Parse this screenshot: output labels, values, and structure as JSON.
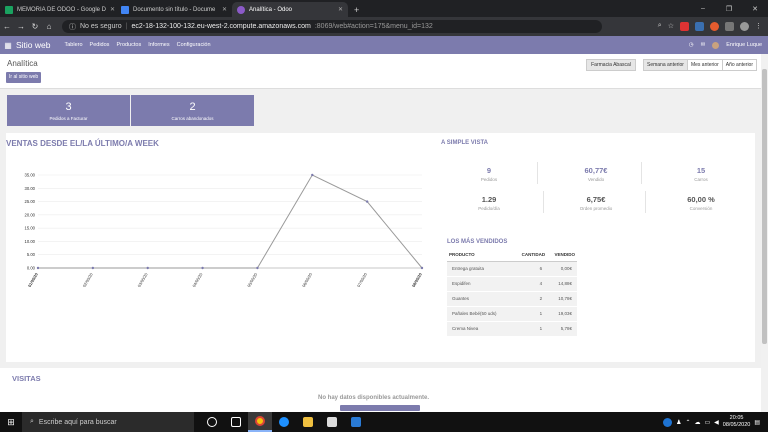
{
  "browser": {
    "tabs": [
      {
        "label": "MEMORIA DE ODOO - Google D",
        "color": "#1aa260"
      },
      {
        "label": "Documento sin título - Docume",
        "color": "#4285f4"
      },
      {
        "label": "Analítica - Odoo",
        "color": "#8b5ac8"
      }
    ],
    "new_tab": "+",
    "security": "No es seguro",
    "url_host": "ec2-18-132-100-132.eu-west-2.compute.amazonaws.com",
    "url_path": ":8069/web#action=175&menu_id=132"
  },
  "odoo_nav": {
    "brand": "Sitio web",
    "menus": [
      "Tablero",
      "Pedidos",
      "Productos",
      "Informes",
      "Configuración"
    ],
    "user": "Enrique Luque"
  },
  "control": {
    "breadcrumb": "Analítica",
    "go_site": "Ir al sitio web",
    "shop": "Farmacia Abascal",
    "periods": [
      "Semana anterior",
      "Mes anterior",
      "Año anterior"
    ]
  },
  "kpis": [
    {
      "value": "3",
      "label": "Pedidos a Facturar"
    },
    {
      "value": "2",
      "label": "Carros abandonados"
    }
  ],
  "sales": {
    "title": "VENTAS DESDE EL/LA ÚLTIMO/A WEEK"
  },
  "chart_data": {
    "type": "line",
    "categories": [
      "01/05/20",
      "02/05/20",
      "03/05/20",
      "04/05/20",
      "05/05/20",
      "06/05/20",
      "07/05/20",
      "08/05/20"
    ],
    "series": [
      {
        "values": [
          0,
          0,
          0,
          0,
          0,
          35.0,
          25.0,
          0
        ]
      }
    ],
    "ylim": [
      0,
      35
    ],
    "yticks": [
      "0.00",
      "5.00",
      "10.00",
      "15.00",
      "20.00",
      "25.00",
      "30.00",
      "35.00"
    ],
    "color": "#9a9a9a",
    "grid": true
  },
  "vista": {
    "title": "A SIMPLE VISTA",
    "stats": [
      {
        "value": "9",
        "label": "Pedidos",
        "accent": true
      },
      {
        "value": "60,77€",
        "label": "Vendido",
        "accent": true
      },
      {
        "value": "15",
        "label": "Carros",
        "accent": true
      },
      {
        "value": "1.29",
        "label": "Pedido/día",
        "accent": false
      },
      {
        "value": "6,75€",
        "label": "Orden promedio",
        "accent": false
      },
      {
        "value": "60,00 %",
        "label": "Conversión",
        "accent": false
      }
    ]
  },
  "best_sellers": {
    "title": "LOS MÁS VENDIDOS",
    "headers": [
      "PRODUCTO",
      "CANTIDAD",
      "VENDIDO"
    ],
    "rows": [
      [
        "Entrega gratuita",
        "6",
        "0,00€"
      ],
      [
        "Espidifen",
        "4",
        "14,88€"
      ],
      [
        "Guantes",
        "2",
        "10,78€"
      ],
      [
        "Pañales Bebé(50 uds)",
        "1",
        "19,03€"
      ],
      [
        "Crema Nivea",
        "1",
        "5,78€"
      ]
    ]
  },
  "visitas": {
    "title": "VISITAS",
    "empty": "No hay datos disponibles actualmente."
  },
  "taskbar": {
    "search": "Escribe aquí para buscar",
    "time": "20:05",
    "date": "08/05/2020"
  }
}
